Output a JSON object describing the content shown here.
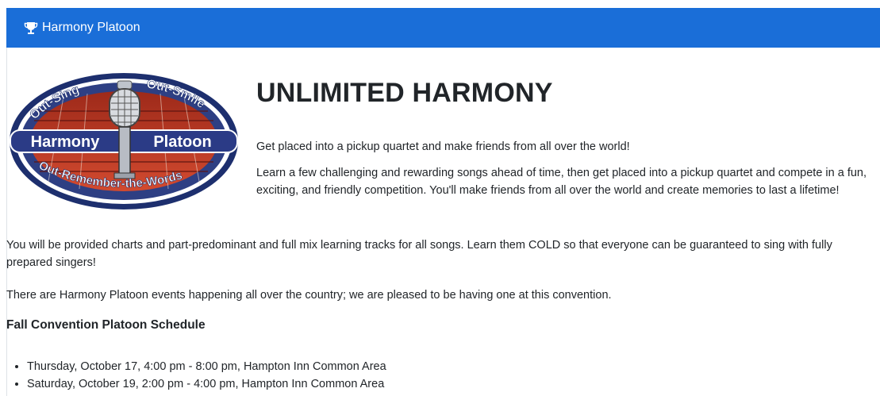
{
  "navbar": {
    "brand_label": "Harmony Platoon",
    "brand_icon": "trophy-icon",
    "background_color": "#1a6ed8"
  },
  "logo": {
    "top_left_text": "Out-Sing",
    "top_right_text": "Out-Smile",
    "left_banner_text": "Harmony",
    "right_banner_text": "Platoon",
    "bottom_text": "Out-Remember-the-Words"
  },
  "hero": {
    "title": "UNLIMITED HARMONY",
    "paragraph_1": "Get placed into a pickup quartet and make friends from all over the world!",
    "paragraph_2": "Learn a few challenging and rewarding songs ahead of time, then get placed into a pickup quartet and compete in a fun, exciting, and friendly competition. You'll make friends from all over the world and create memories to last a lifetime!"
  },
  "body": {
    "paragraph_1": "You will be provided charts and part-predominant and full mix learning tracks for all songs. Learn them COLD so that everyone can be guaranteed to sing with fully prepared singers!",
    "paragraph_2": "There are Harmony Platoon events happening all over the country; we are pleased to be having one at this convention."
  },
  "schedule": {
    "title": "Fall Convention Platoon Schedule",
    "items": [
      "Thursday, October 17, 4:00 pm - 8:00 pm, Hampton Inn Common Area",
      "Saturday, October 19, 2:00 pm - 4:00 pm, Hampton Inn Common Area"
    ]
  }
}
